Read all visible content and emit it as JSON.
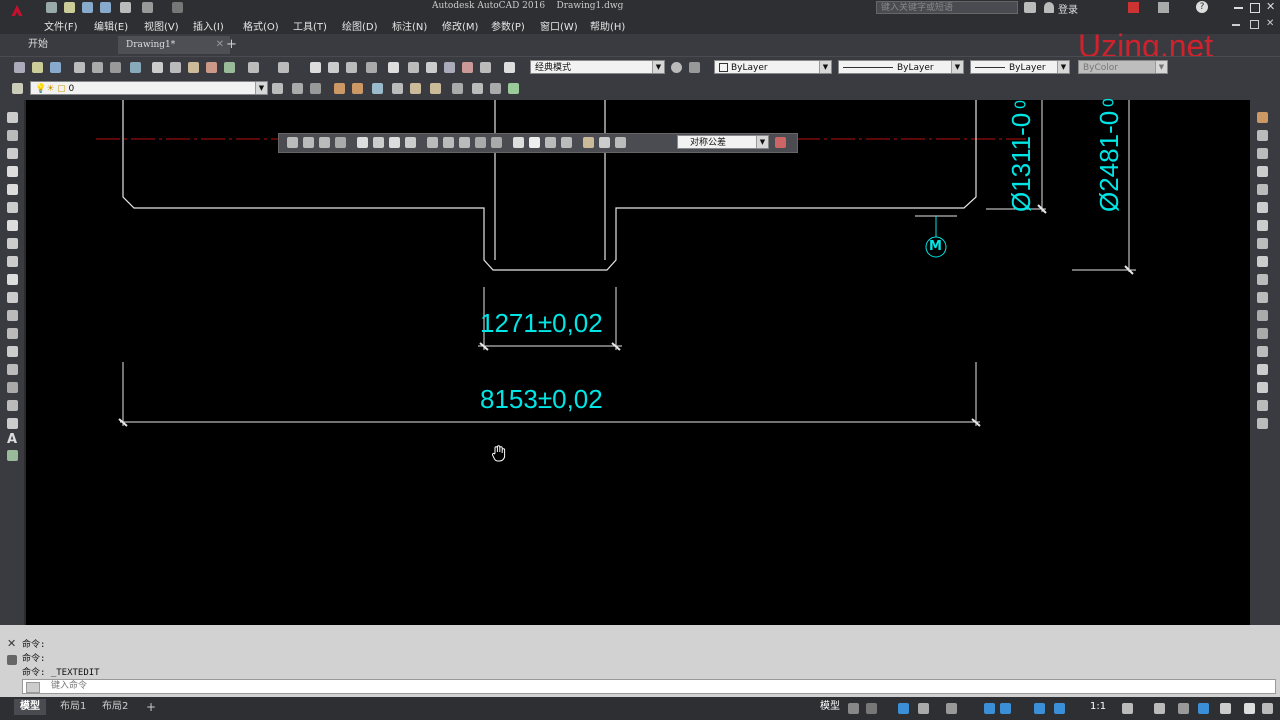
{
  "titlebar": {
    "title": "Autodesk AutoCAD 2016    Drawing1.dwg",
    "search_placeholder": "键入关键字或短语",
    "login": "登录"
  },
  "menu": [
    "文件(F)",
    "编辑(E)",
    "视图(V)",
    "插入(I)",
    "格式(O)",
    "工具(T)",
    "绘图(D)",
    "标注(N)",
    "修改(M)",
    "参数(P)",
    "窗口(W)",
    "帮助(H)"
  ],
  "tabs": {
    "start": "开始",
    "drawing": "Drawing1*",
    "add": "+"
  },
  "toolbar": {
    "workspace": "经典模式",
    "layer_color": "ByLayer",
    "linetype": "ByLayer",
    "lineweight": "ByLayer",
    "plotstyle": "ByColor",
    "layer": "0"
  },
  "dim_toolbar": {
    "dimstyle": "对称公差"
  },
  "watermark": "Uzing.net",
  "drawing": {
    "dim1": "1271±0,02",
    "dim2": "8153±0,02",
    "dim3": "Ø1311-0",
    "dim4": "Ø2481-0",
    "datum": "M",
    "zero1": "0",
    "zero2": "0"
  },
  "command": {
    "line1": "命令:",
    "line2": "命令:",
    "line3": "命令: _TEXTEDIT",
    "placeholder": "键入命令"
  },
  "status": {
    "model_tab": "模型",
    "layout1": "布局1",
    "layout2": "布局2",
    "model_btn": "模型",
    "scale": "1:1"
  },
  "colors": {
    "dim": "#00e5e5",
    "accent": "#c8102e",
    "watermark": "#e0202a"
  }
}
